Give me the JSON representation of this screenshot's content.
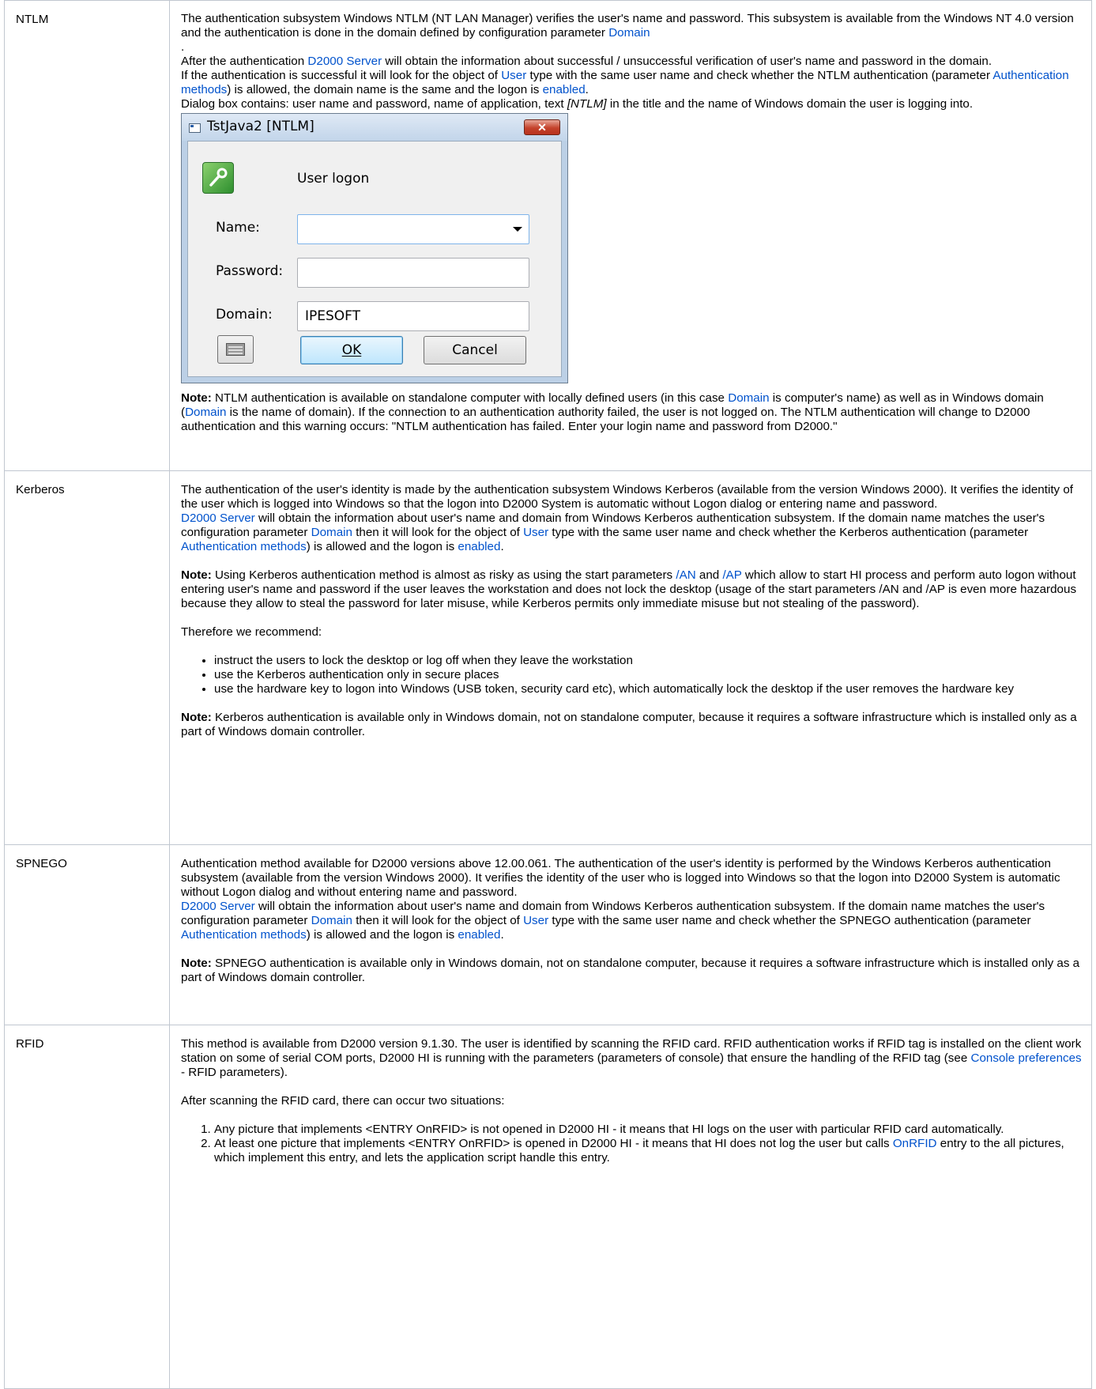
{
  "rows": {
    "ntlm": {
      "name": "NTLM",
      "p1a": "The authentication subsystem Windows NTLM (NT LAN Manager) verifies the user's name and password. This subsystem is available from the Windows NT 4.0 version and the authentication is done in the domain defined by configuration parameter ",
      "p1_link": "Domain",
      "p1b": ".",
      "p2a": "After the authentication ",
      "p2_link": "D2000 Server",
      "p2b": " will obtain the information about successful / unsuccessful verification of user's name and password in the domain.",
      "p3a": "If the authentication is successful it will look for the object of ",
      "p3_link1": "User",
      "p3b": " type with the same user name and check whether the NTLM authentication (parameter ",
      "p3_link2": "Authentication methods",
      "p3c": ") is allowed, the domain name is the same and the logon is ",
      "p3_link3": "enabled",
      "p3d": ".",
      "p4a": "Dialog box contains: user name and password, name of application, text ",
      "p4_em": "[NTLM]",
      "p4b": " in the title and the name of Windows domain the user is logging into.",
      "dialog": {
        "title": "TstJava2 [NTLM]",
        "close": "✕",
        "heading": "User logon",
        "name_label": "Name:",
        "name_value": "",
        "password_label": "Password:",
        "password_value": "",
        "domain_label": "Domain:",
        "domain_value": "IPESOFT",
        "ok": "OK",
        "cancel": "Cancel"
      },
      "note_label": "Note:",
      "note_a": " NTLM authentication is available on standalone computer with locally defined users (in this case ",
      "note_link1": "Domain",
      "note_b": " is computer's name) as well as in Windows domain (",
      "note_link2": "Domain",
      "note_c": " is the name of domain). If the connection to an authentication authority failed, the user is not logged on. The NTLM authentication will change to D2000 authentication and this warning occurs: \"NTLM authentication has failed. Enter your login name and password from D2000.\""
    },
    "kerberos": {
      "name": "Kerberos",
      "p1": "The authentication of the user's identity is made by the authentication subsystem Windows Kerberos (available from the version Windows 2000). It verifies the identity of the user which is logged into Windows so that the logon into D2000 System is automatic without Logon dialog or entering name and password.",
      "p2_link1": "D2000 Server",
      "p2a": " will obtain the information about user's name and domain from Windows Kerberos authentication subsystem. If the domain name matches the user's configuration parameter ",
      "p2_link2": "Domain",
      "p2b": " then it will look for the object of ",
      "p2_link3": "User",
      "p2c": " type with the same user name and check whether the Kerberos authentication (parameter ",
      "p2_link4": "Authentication methods",
      "p2d": ") is allowed and the logon is ",
      "p2_link5": "enabled",
      "p2e": ".",
      "note1_label": "Note:",
      "note1_a": " Using Kerberos authentication method is almost as risky as using the start parameters ",
      "note1_link1": "/AN",
      "note1_b": " and ",
      "note1_link2": "/AP",
      "note1_c": " which allow to start HI process and perform auto logon without entering user's name and password if the user leaves the workstation and does not lock the desktop (usage of the start parameters /AN and /AP is even more hazardous because they allow to steal the password for later misuse, while Kerberos permits only immediate misuse but not stealing of the password).",
      "recommend": "Therefore we recommend:",
      "bullets": [
        "instruct the users to lock the desktop or log off when they leave the workstation",
        "use the Kerberos authentication only in secure places",
        "use the hardware key to logon into Windows (USB token, security card etc), which automatically lock the desktop if the user removes the hardware key"
      ],
      "note2_label": "Note:",
      "note2": " Kerberos authentication is available only in Windows domain, not on standalone computer, because it requires a software infrastructure which is installed only as a part of Windows domain controller."
    },
    "spnego": {
      "name": "SPNEGO",
      "p1": "Authentication method available for D2000 versions above 12.00.061. The authentication of the user's identity is performed by the Windows Kerberos authentication subsystem (available from the version Windows 2000). It verifies the identity of the user who is logged into Windows so that the logon into D2000 System is automatic without Logon dialog and without entering name and password.",
      "p2_link1": "D2000 Server",
      "p2a": " will obtain the information about user's name and domain from Windows Kerberos authentication subsystem. If the domain name matches the user's configuration parameter ",
      "p2_link2": "Domain",
      "p2b": " then it will look for the object of ",
      "p2_link3": "User",
      "p2c": " type with the same user name and check whether the SPNEGO authentication (parameter ",
      "p2_link4": "Authentication methods",
      "p2d": ") is allowed and the logon is ",
      "p2_link5": "enabled",
      "p2e": ".",
      "note_label": "Note:",
      "note": " SPNEGO authentication is available only in Windows domain, not on standalone computer, because it requires a software infrastructure which is installed only as a part of Windows domain controller."
    },
    "rfid": {
      "name": "RFID",
      "p1a": "This method is available from D2000 version 9.1.30. The user is identified by scanning the RFID card. RFID authentication works if RFID tag is installed on the client work station on some of serial COM ports, D2000 HI is running with the parameters (parameters of console) that ensure the handling of the RFID tag (see ",
      "p1_link": "Console preferences",
      "p1b": " - RFID parameters).",
      "p2": "After scanning the RFID card, there can occur two situations:",
      "item1": "Any picture that implements <ENTRY OnRFID> is not opened in D2000 HI - it means that HI logs on the user with particular RFID card automatically.",
      "item2a": "At least one picture that implements <ENTRY OnRFID> is opened in D2000 HI - it means that HI does not log the user but calls ",
      "item2_link": "OnRFID",
      "item2b": " entry to the all pictures, which implement this entry, and lets the application script handle this entry."
    }
  }
}
